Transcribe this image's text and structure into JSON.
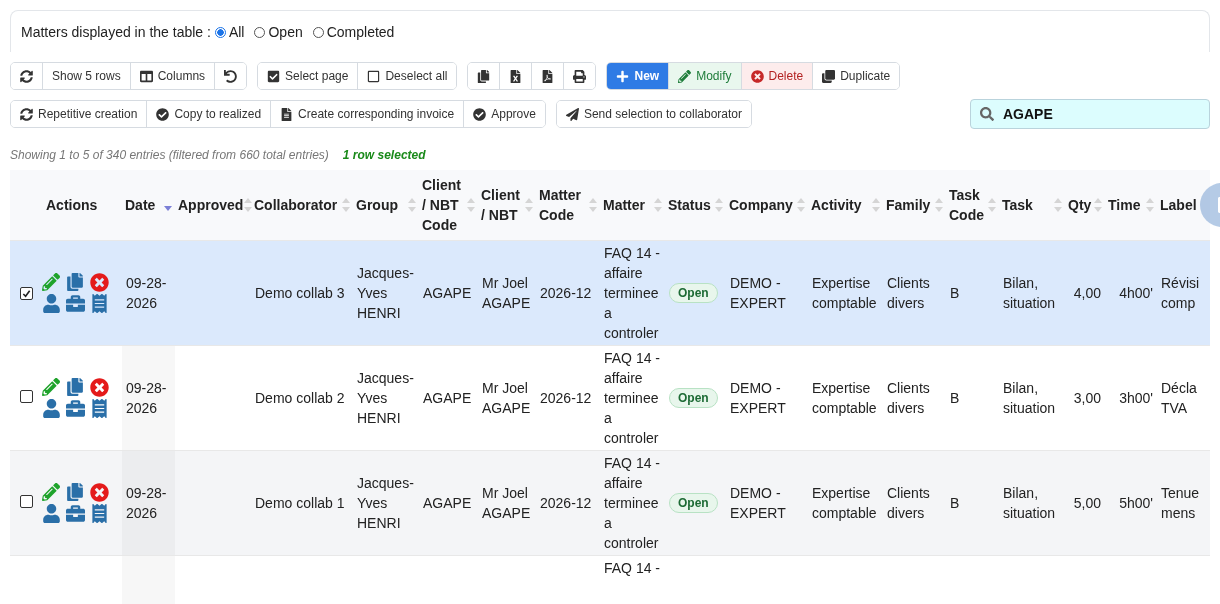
{
  "filter": {
    "label": "Matters displayed in the table :",
    "options": [
      {
        "label": "All",
        "selected": true
      },
      {
        "label": "Open",
        "selected": false
      },
      {
        "label": "Completed",
        "selected": false
      }
    ]
  },
  "toolbar_rows": [
    [
      {
        "buttons": [
          {
            "kind": "refresh"
          },
          {
            "kind": "plain",
            "label": "Show 5 rows"
          },
          {
            "kind": "columns",
            "label": "Columns"
          },
          {
            "kind": "reset"
          }
        ]
      },
      {
        "buttons": [
          {
            "kind": "check",
            "label": "Select page"
          },
          {
            "kind": "uncheck",
            "label": "Deselect all"
          }
        ]
      },
      {
        "buttons": [
          {
            "kind": "copy"
          },
          {
            "kind": "excel"
          },
          {
            "kind": "pdf"
          },
          {
            "kind": "print"
          }
        ]
      },
      {
        "buttons": [
          {
            "kind": "new",
            "label": "New"
          },
          {
            "kind": "modify",
            "label": "Modify"
          },
          {
            "kind": "delete",
            "label": "Delete"
          },
          {
            "kind": "duplicate",
            "label": "Duplicate"
          }
        ]
      }
    ],
    [
      {
        "buttons": [
          {
            "kind": "repeat",
            "label": "Repetitive creation"
          },
          {
            "kind": "approve",
            "label": "Copy to realized"
          },
          {
            "kind": "invoice",
            "label": "Create corresponding invoice"
          },
          {
            "kind": "approve",
            "label": "Approve"
          }
        ]
      },
      {
        "buttons": [
          {
            "kind": "send",
            "label": "Send selection to collaborator"
          }
        ]
      }
    ]
  ],
  "search": {
    "value": "AGAPE"
  },
  "info": "Showing 1 to 5 of 340 entries (filtered from 660 total entries)",
  "selection_info": "1 row selected",
  "table": {
    "columns": [
      {
        "label": "Actions",
        "sortable": false
      },
      {
        "label": "Date",
        "sortable": true,
        "sorted_desc": true
      },
      {
        "label": "Approved",
        "sortable": true,
        "sorted_desc": false
      },
      {
        "label": "Collaborator",
        "sortable": true,
        "sorted_desc": false
      },
      {
        "label": "Group",
        "sortable": true,
        "sorted_desc": false
      },
      {
        "label": "Client / NBT Code",
        "sortable": true,
        "sorted_desc": false
      },
      {
        "label": "Client / NBT",
        "sortable": true,
        "sorted_desc": false
      },
      {
        "label": "Matter Code",
        "sortable": true,
        "sorted_desc": false
      },
      {
        "label": "Matter",
        "sortable": true,
        "sorted_desc": false
      },
      {
        "label": "Status",
        "sortable": true,
        "sorted_desc": false
      },
      {
        "label": "Company",
        "sortable": true,
        "sorted_desc": false
      },
      {
        "label": "Activity",
        "sortable": true,
        "sorted_desc": false
      },
      {
        "label": "Family",
        "sortable": true,
        "sorted_desc": false
      },
      {
        "label": "Task Code",
        "sortable": true,
        "sorted_desc": false
      },
      {
        "label": "Task",
        "sortable": true,
        "sorted_desc": false
      },
      {
        "label": "Qty",
        "sortable": true,
        "sorted_desc": false
      },
      {
        "label": "Time",
        "sortable": true,
        "sorted_desc": false
      },
      {
        "label": "Label",
        "sortable": false
      }
    ],
    "rows": [
      {
        "selected": true,
        "date": "09-28-2026",
        "collaborator": "Demo collab 3",
        "group": "Jacques-Yves HENRI",
        "client_code": "AGAPE",
        "client": "Mr Joel AGAPE",
        "matter_code": "2026-12",
        "matter": "FAQ 14 - affaire terminee a controler",
        "status": "Open",
        "company": "DEMO - EXPERT",
        "activity": "Expertise comptable",
        "family": "Clients divers",
        "task_code": "B",
        "task": "Bilan, situation",
        "qty": "4,00",
        "time": "4h00'",
        "label": "Révisi comp"
      },
      {
        "selected": false,
        "date": "09-28-2026",
        "collaborator": "Demo collab 2",
        "group": "Jacques-Yves HENRI",
        "client_code": "AGAPE",
        "client": "Mr Joel AGAPE",
        "matter_code": "2026-12",
        "matter": "FAQ 14 - affaire terminee a controler",
        "status": "Open",
        "company": "DEMO - EXPERT",
        "activity": "Expertise comptable",
        "family": "Clients divers",
        "task_code": "B",
        "task": "Bilan, situation",
        "qty": "3,00",
        "time": "3h00'",
        "label": "Décla TVA"
      },
      {
        "selected": false,
        "date": "09-28-2026",
        "collaborator": "Demo collab 1",
        "group": "Jacques-Yves HENRI",
        "client_code": "AGAPE",
        "client": "Mr Joel AGAPE",
        "matter_code": "2026-12",
        "matter": "FAQ 14 - affaire terminee a controler",
        "status": "Open",
        "company": "DEMO - EXPERT",
        "activity": "Expertise comptable",
        "family": "Clients divers",
        "task_code": "B",
        "task": "Bilan, situation",
        "qty": "5,00",
        "time": "5h00'",
        "label": "Tenue mens"
      }
    ],
    "cut_row": {
      "matter": "FAQ 14 -"
    }
  }
}
